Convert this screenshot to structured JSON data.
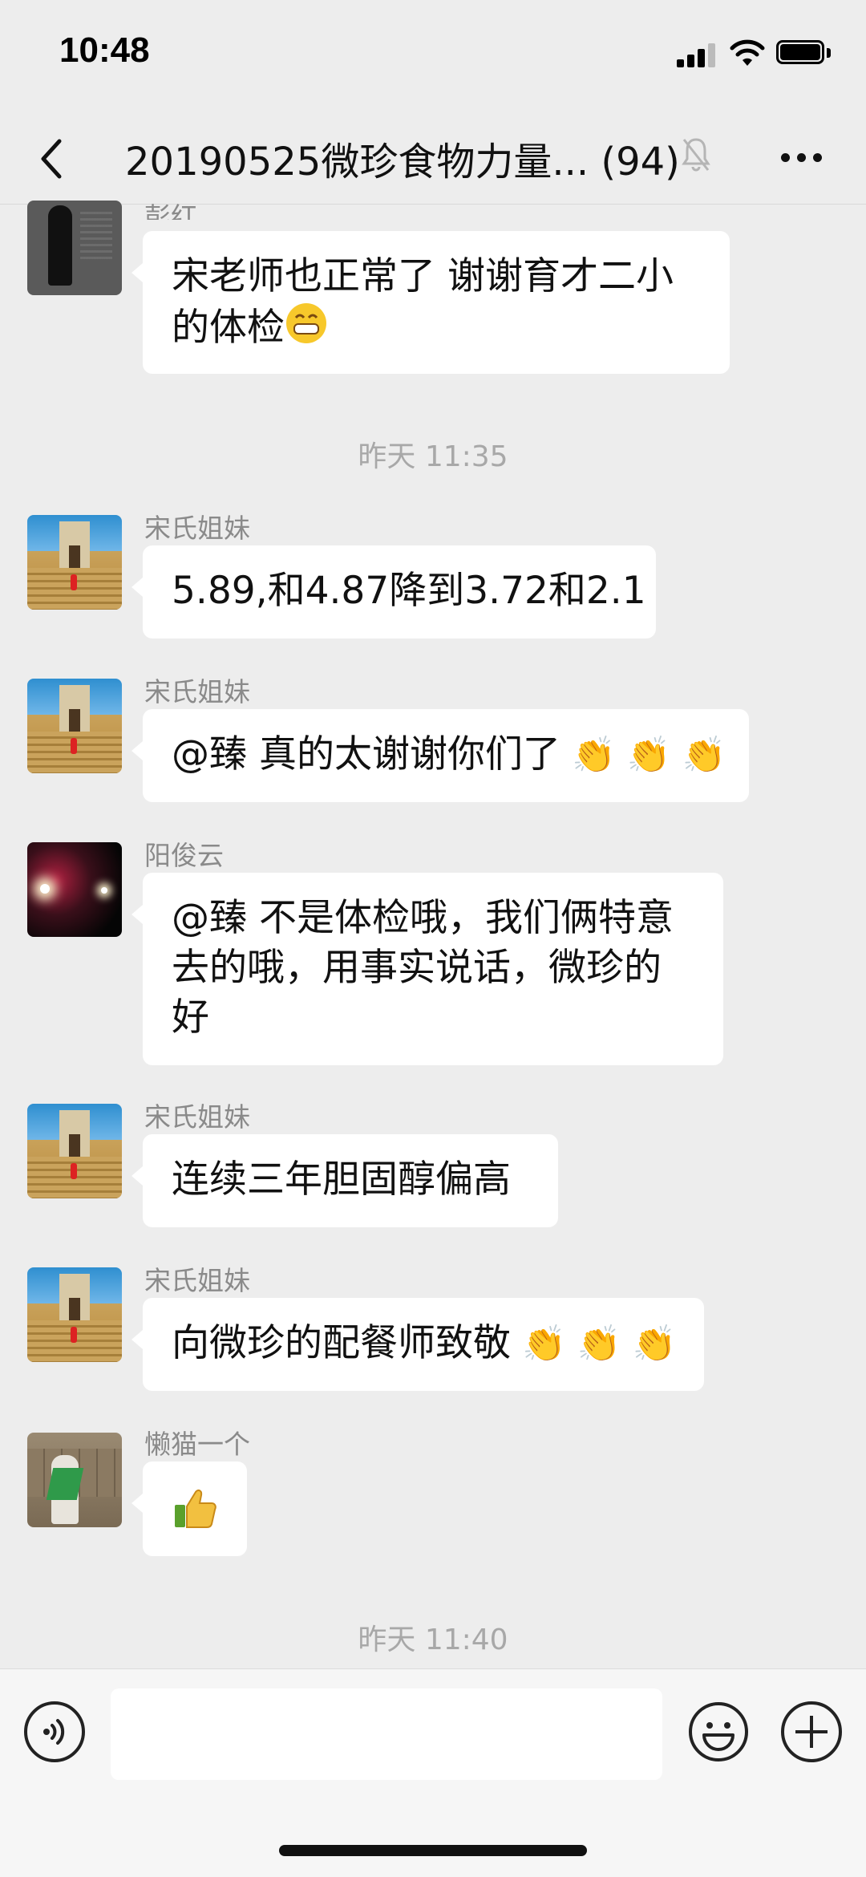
{
  "status_bar": {
    "time": "10:48"
  },
  "header": {
    "title": "20190525微珍食物力量... (94)"
  },
  "messages": [
    {
      "sender": "彭红",
      "lines": [
        "宋老师也正常了 谢谢育才二小",
        "的体检"
      ],
      "emoji": "grin"
    },
    {
      "timestamp": "昨天 11:35"
    },
    {
      "sender": "宋氏姐妹",
      "lines": [
        "5.89,和4.87降到3.72和2.1"
      ]
    },
    {
      "sender": "宋氏姐妹",
      "lines": [
        "@臻 真的太谢谢你们了"
      ],
      "emoji": "clap x3"
    },
    {
      "sender": "阳俊云",
      "lines": [
        "@臻 不是体检哦，我们俩特意",
        "去的哦，用事实说话，微珍的",
        "好"
      ]
    },
    {
      "sender": "宋氏姐妹",
      "lines": [
        "连续三年胆固醇偏高"
      ]
    },
    {
      "sender": "宋氏姐妹",
      "lines": [
        "向微珍的配餐师致敬"
      ],
      "emoji": "clap x3"
    },
    {
      "sender": "懒猫一个",
      "lines": [
        ""
      ],
      "emoji": "thumbs-up"
    },
    {
      "timestamp": "昨天 11:40"
    }
  ],
  "input": {
    "placeholder": ""
  },
  "colors": {
    "background": "#ededed",
    "bubble": "#ffffff",
    "sender": "#8a8a8a",
    "timestamp": "#a8a8a8"
  }
}
